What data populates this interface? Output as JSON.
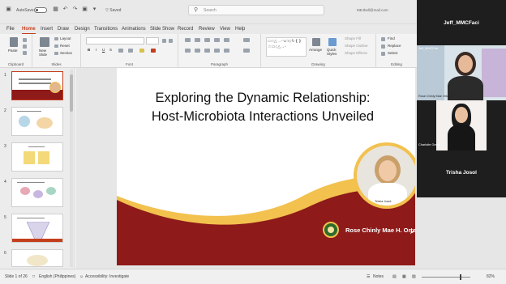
{
  "titlebar": {
    "autosave_label": "AutoSave",
    "filename": "▽ Saved",
    "search_placeholder": "Search",
    "user": "MEJbell@mail.com"
  },
  "tabs": [
    "File",
    "Home",
    "Insert",
    "Draw",
    "Design",
    "Transitions",
    "Animations",
    "Slide Show",
    "Record",
    "Review",
    "View",
    "Help"
  ],
  "active_tab": "Home",
  "ribbon": {
    "groups": [
      "Clipboard",
      "Slides",
      "Font",
      "Paragraph",
      "Drawing",
      "Editing"
    ],
    "clipboard": {
      "paste": "Paste"
    },
    "slides": {
      "new_slide": "New Slide",
      "layout": "Layout",
      "reset": "Reset",
      "section": "Section"
    },
    "drawing": {
      "arrange": "Arrange",
      "quick_styles": "Quick Styles",
      "shape_fill": "Shape Fill",
      "shape_outline": "Shape Outline",
      "shape_effects": "Shape Effects"
    },
    "editing": {
      "find": "Find",
      "replace": "Replace",
      "select": "Select"
    }
  },
  "thumbnails": [
    {
      "number": "1",
      "active": true
    },
    {
      "number": "2",
      "active": false
    },
    {
      "number": "3",
      "active": false
    },
    {
      "number": "4",
      "active": false
    },
    {
      "number": "5",
      "active": false
    },
    {
      "number": "6",
      "active": false
    }
  ],
  "slide": {
    "title_line1": "Exploring the Dynamic Relationship:",
    "title_line2": "Host-Microbiota Interactions Unveiled",
    "presenter": "Rose Chinly Mae H. Ortega-Kindica",
    "video_caption": "Trisha Josol"
  },
  "statusbar": {
    "slide_counter": "Slide 1 of 26",
    "language": "English (Philippines)",
    "accessibility": "Accessibility: Investigate",
    "notes": "Notes",
    "zoom": "82%"
  },
  "call": {
    "participants": [
      {
        "name": "Jeff_MMCFaci",
        "caption": "Jeff_MMCFaci"
      },
      {
        "name": "",
        "caption": "Rose Chinly Mae Ortega"
      },
      {
        "name": "",
        "caption": "Charlotte Gregg"
      },
      {
        "name": "Trisha Josol",
        "caption": ""
      }
    ]
  },
  "colors": {
    "accent": "#c43e1c",
    "slide_maroon": "#8e1a1a",
    "slide_gold": "#f2c14e"
  }
}
